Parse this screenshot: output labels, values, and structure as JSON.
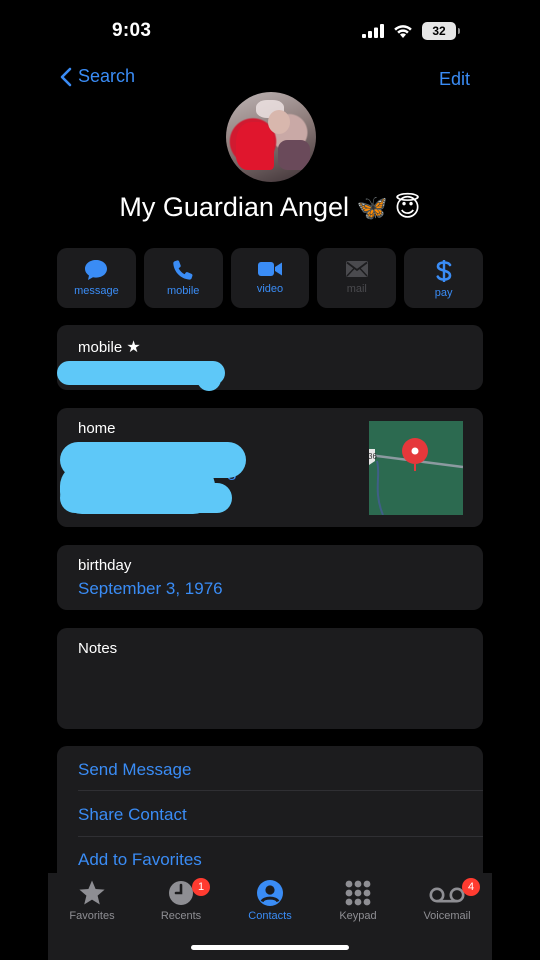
{
  "status_bar": {
    "time": "9:03",
    "battery": "32"
  },
  "nav": {
    "back_label": "Search",
    "edit_label": "Edit"
  },
  "contact": {
    "name": "My Guardian Angel",
    "emojis": "🦋 😇"
  },
  "actions": [
    {
      "label": "message",
      "icon": "message-bubble-icon",
      "enabled": true
    },
    {
      "label": "mobile",
      "icon": "phone-icon",
      "enabled": true
    },
    {
      "label": "video",
      "icon": "video-camera-icon",
      "enabled": true
    },
    {
      "label": "mail",
      "icon": "envelope-icon",
      "enabled": false
    },
    {
      "label": "pay",
      "icon": "dollar-icon",
      "enabled": true
    }
  ],
  "phone": {
    "label": "mobile",
    "star": "★"
  },
  "address": {
    "label": "home",
    "visible_fragment": "8",
    "map_shield": "36"
  },
  "birthday": {
    "label": "birthday",
    "value": "September 3, 1976"
  },
  "notes": {
    "label": "Notes"
  },
  "list_actions": [
    "Send Message",
    "Share Contact",
    "Add to Favorites"
  ],
  "tabs": [
    {
      "label": "Favorites",
      "icon": "star-icon",
      "active": false,
      "badge": ""
    },
    {
      "label": "Recents",
      "icon": "clock-icon",
      "active": false,
      "badge": "1"
    },
    {
      "label": "Contacts",
      "icon": "person-circle-icon",
      "active": true,
      "badge": ""
    },
    {
      "label": "Keypad",
      "icon": "keypad-grid-icon",
      "active": false,
      "badge": ""
    },
    {
      "label": "Voicemail",
      "icon": "voicemail-icon",
      "active": false,
      "badge": "4"
    }
  ],
  "colors": {
    "accent": "#3a8cf5",
    "card": "#1c1c1e",
    "badge": "#ff3b30",
    "redaction": "#5ec8f8",
    "disabled": "#4a4a4e"
  }
}
